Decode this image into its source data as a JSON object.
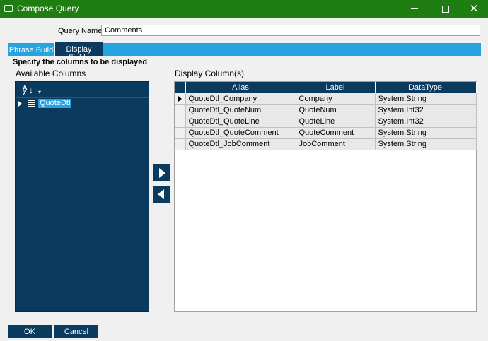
{
  "window": {
    "title": "Compose Query",
    "minimize_glyph": "—",
    "maximize_glyph": "☐",
    "close_glyph": "✕"
  },
  "query_name": {
    "label": "Query Name:",
    "value": "Comments"
  },
  "tabs": [
    {
      "label": "Phrase Build",
      "active": false
    },
    {
      "label": "Display Fields",
      "active": true
    }
  ],
  "instruction": "Specify the columns to be displayed",
  "available": {
    "label": "Available Columns",
    "sort_glyph_letters": "A\nZ",
    "tree": [
      {
        "label": "QuoteDtl",
        "icon": "table-icon",
        "expanded": false
      }
    ]
  },
  "display": {
    "label": "Display Column(s)",
    "columns": [
      "Alias",
      "Label",
      "DataType"
    ],
    "rows": [
      {
        "alias": "QuoteDtl_Company",
        "label": "Company",
        "datatype": "System.String",
        "current": true
      },
      {
        "alias": "QuoteDtl_QuoteNum",
        "label": "QuoteNum",
        "datatype": "System.Int32",
        "current": false
      },
      {
        "alias": "QuoteDtl_QuoteLine",
        "label": "QuoteLine",
        "datatype": "System.Int32",
        "current": false
      },
      {
        "alias": "QuoteDtl_QuoteComment",
        "label": "QuoteComment",
        "datatype": "System.String",
        "current": false
      },
      {
        "alias": "QuoteDtl_JobComment",
        "label": "JobComment",
        "datatype": "System.String",
        "current": false
      }
    ]
  },
  "buttons": {
    "ok": "OK",
    "cancel": "Cancel"
  },
  "colors": {
    "titlebar": "#1e7e12",
    "accent": "#27a3e0",
    "dark_panel": "#0a3a5e"
  }
}
